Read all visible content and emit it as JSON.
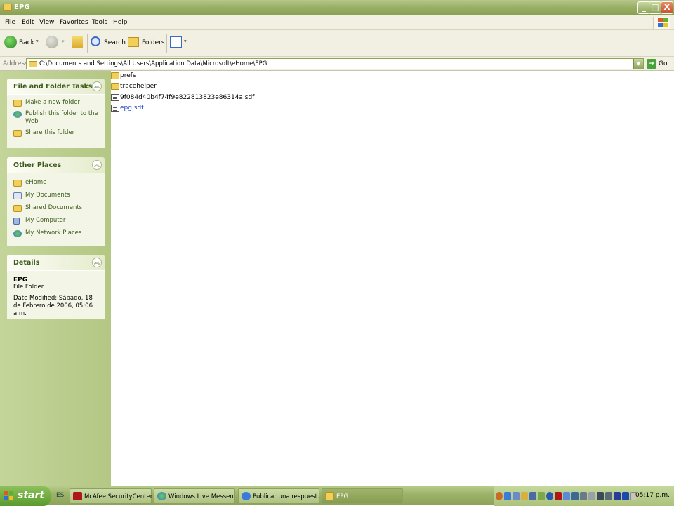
{
  "window": {
    "title": "EPG",
    "controls": {
      "minimize": "_",
      "maximize": "□",
      "close": "X"
    }
  },
  "menu": {
    "items": [
      "File",
      "Edit",
      "View",
      "Favorites",
      "Tools",
      "Help"
    ]
  },
  "toolbar": {
    "back_label": "Back",
    "search_label": "Search",
    "folders_label": "Folders"
  },
  "address": {
    "label": "Address",
    "value": "C:\\Documents and Settings\\All Users\\Application Data\\Microsoft\\eHome\\EPG",
    "go_label": "Go"
  },
  "left_pane": {
    "file_tasks": {
      "title": "File and Folder Tasks",
      "items": [
        "Make a new folder",
        "Publish this folder to the Web",
        "Share this folder"
      ]
    },
    "other_places": {
      "title": "Other Places",
      "items": [
        "eHome",
        "My Documents",
        "Shared Documents",
        "My Computer",
        "My Network Places"
      ]
    },
    "details": {
      "title": "Details",
      "name": "EPG",
      "type": "File Folder",
      "modified": "Date Modified: Sábado, 18 de Febrero de 2006, 05:06 a.m."
    }
  },
  "files": [
    {
      "name": "prefs",
      "kind": "folder"
    },
    {
      "name": "tracehelper",
      "kind": "folder"
    },
    {
      "name": "9f084d40b4f74f9e822813823e86314a.sdf",
      "kind": "file"
    },
    {
      "name": "epg.sdf",
      "kind": "file"
    }
  ],
  "taskbar": {
    "start_label": "start",
    "language": "ES",
    "buttons": [
      "McAfee SecurityCenter",
      "Windows Live Messen...",
      "Publicar una respuest...",
      "EPG"
    ],
    "clock": "05:17 p.m."
  },
  "colors": {
    "accent": "#8aa154",
    "task_text": "#3d5a1c",
    "link_blue": "#1a40c0"
  }
}
